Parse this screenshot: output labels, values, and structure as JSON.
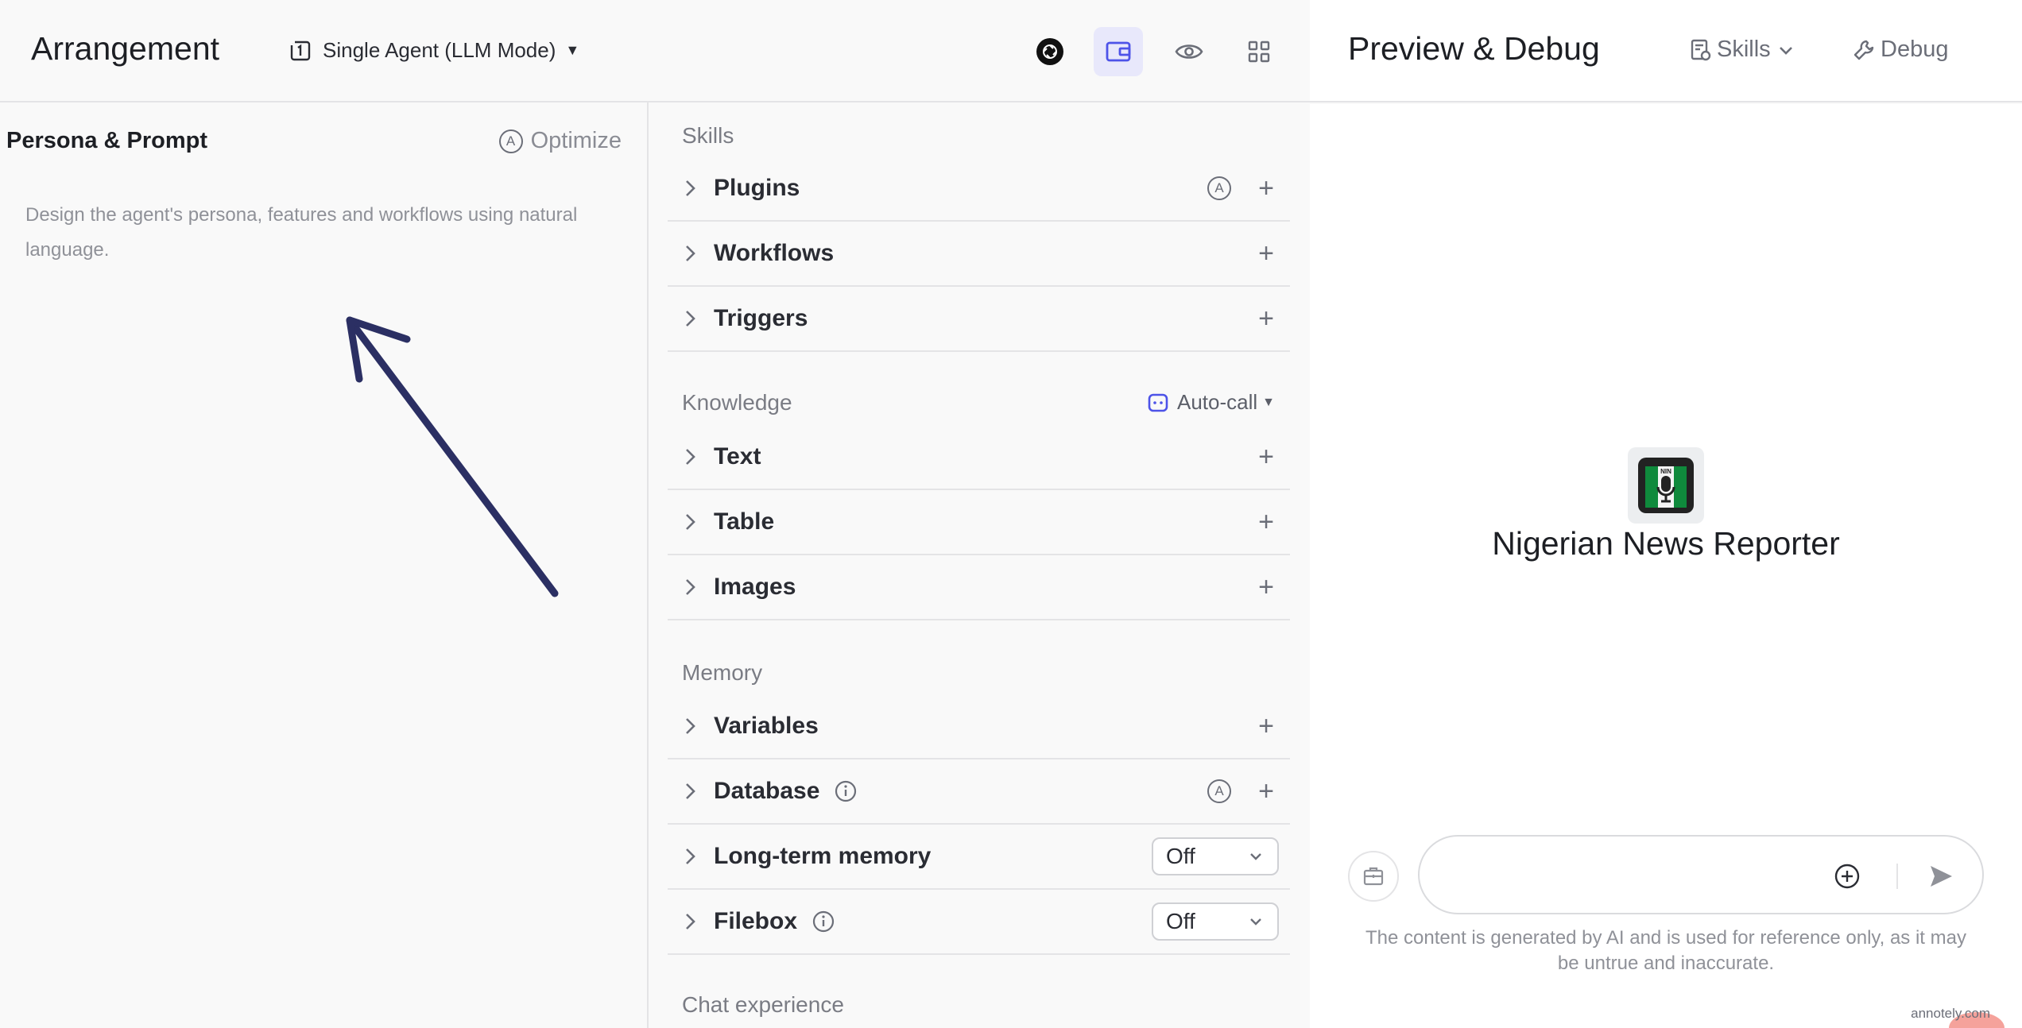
{
  "header": {
    "title": "Arrangement",
    "mode_label": "Single Agent (LLM Mode)",
    "icons": [
      "openai-model-icon",
      "wallet-card-icon",
      "eye-icon",
      "grid-icon"
    ]
  },
  "preview_header": {
    "title": "Preview & Debug",
    "skills_label": "Skills",
    "debug_label": "Debug"
  },
  "persona": {
    "title": "Persona & Prompt",
    "optimize_label": "Optimize",
    "optimize_icon_letter": "A",
    "placeholder": "Design the agent's persona, features and workflows using natural language."
  },
  "skills": {
    "heading": "Skills",
    "items": [
      {
        "label": "Plugins"
      },
      {
        "label": "Workflows"
      },
      {
        "label": "Triggers"
      }
    ]
  },
  "knowledge": {
    "heading": "Knowledge",
    "auto_call_label": "Auto-call",
    "items": [
      {
        "label": "Text"
      },
      {
        "label": "Table"
      },
      {
        "label": "Images"
      }
    ]
  },
  "memory": {
    "heading": "Memory",
    "items": [
      {
        "label": "Variables"
      },
      {
        "label": "Database"
      },
      {
        "label": "Long-term memory",
        "value": "Off"
      },
      {
        "label": "Filebox",
        "value": "Off"
      }
    ]
  },
  "chat_experience": {
    "heading": "Chat experience"
  },
  "preview": {
    "bot_name": "Nigerian News Reporter",
    "avatar_text": "NIN",
    "input_placeholder": "",
    "disclaimer": "The content is generated by AI and is used for reference only, as it may be untrue and inaccurate."
  },
  "watermark": "annotely.com",
  "colors": {
    "accent": "#4d53e8",
    "arrow": "#2b2f63",
    "active_bg": "#e8e8fb",
    "flag_green": "#0f8a3c"
  }
}
